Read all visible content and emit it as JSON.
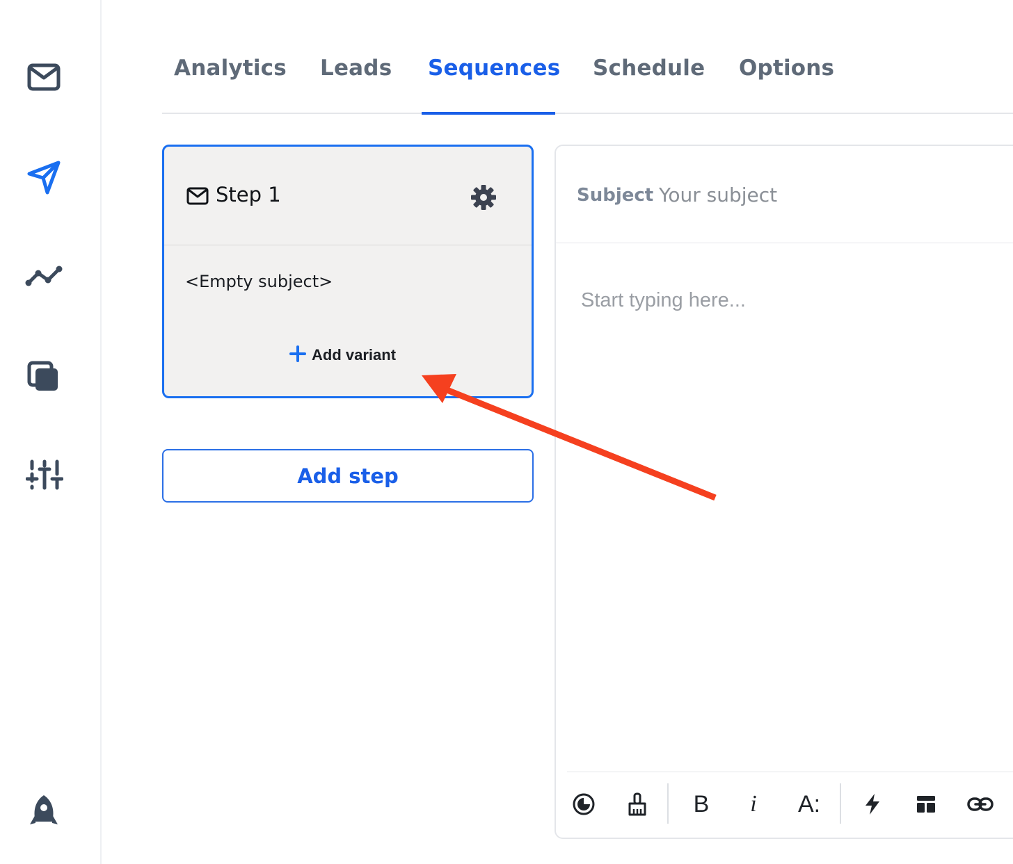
{
  "sidebar": {
    "items": [
      {
        "icon": "mail-icon",
        "active": false
      },
      {
        "icon": "send-icon",
        "active": true
      },
      {
        "icon": "analytics-trend-icon",
        "active": false
      },
      {
        "icon": "copy-icon",
        "active": false
      },
      {
        "icon": "sliders-icon",
        "active": false
      }
    ],
    "bottom_icon": "rocket-icon"
  },
  "tabs": [
    {
      "label": "Analytics",
      "active": false
    },
    {
      "label": "Leads",
      "active": false
    },
    {
      "label": "Sequences",
      "active": true
    },
    {
      "label": "Schedule",
      "active": false
    },
    {
      "label": "Options",
      "active": false
    }
  ],
  "step": {
    "title": "Step 1",
    "subject": "<Empty subject>",
    "add_variant_label": "Add variant"
  },
  "add_step_label": "Add step",
  "editor": {
    "subject_label": "Subject",
    "subject_placeholder": "Your subject",
    "body_placeholder": "Start typing here...",
    "toolbar": {
      "bold_label": "B",
      "italic_label": "i",
      "font_size_label": "A:",
      "icons": [
        "preview-icon",
        "clean-format-icon",
        "bold-icon",
        "italic-icon",
        "font-size-icon",
        "flash-icon",
        "template-icon",
        "link-icon"
      ]
    }
  },
  "colors": {
    "accent": "#1a5fe8",
    "sidebar_icon": "#3c4a5c",
    "annotation_arrow": "#f5401f"
  }
}
